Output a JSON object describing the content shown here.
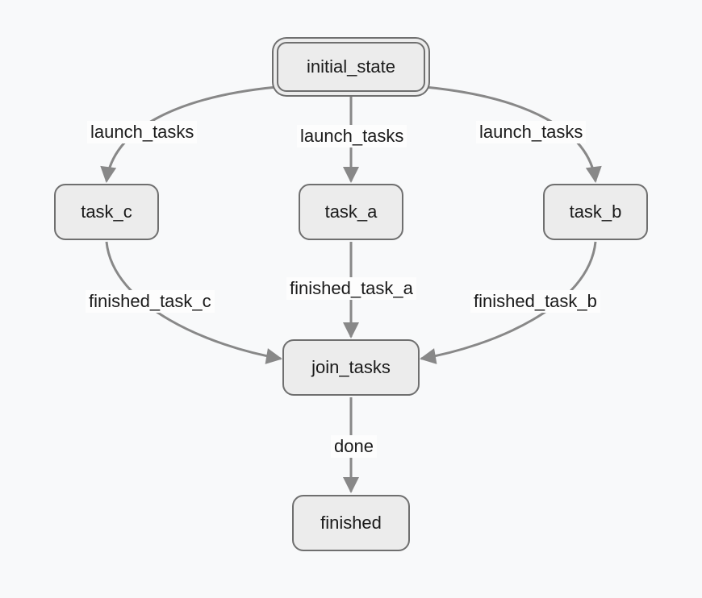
{
  "nodes": {
    "initial_state": {
      "label": "initial_state",
      "kind": "initial"
    },
    "task_c": {
      "label": "task_c",
      "kind": "state"
    },
    "task_a": {
      "label": "task_a",
      "kind": "state"
    },
    "task_b": {
      "label": "task_b",
      "kind": "state"
    },
    "join_tasks": {
      "label": "join_tasks",
      "kind": "state"
    },
    "finished": {
      "label": "finished",
      "kind": "state"
    }
  },
  "edges": {
    "initial_to_task_c": {
      "from": "initial_state",
      "to": "task_c",
      "label": "launch_tasks"
    },
    "initial_to_task_a": {
      "from": "initial_state",
      "to": "task_a",
      "label": "launch_tasks"
    },
    "initial_to_task_b": {
      "from": "initial_state",
      "to": "task_b",
      "label": "launch_tasks"
    },
    "task_c_to_join": {
      "from": "task_c",
      "to": "join_tasks",
      "label": "finished_task_c"
    },
    "task_a_to_join": {
      "from": "task_a",
      "to": "join_tasks",
      "label": "finished_task_a"
    },
    "task_b_to_join": {
      "from": "task_b",
      "to": "join_tasks",
      "label": "finished_task_b"
    },
    "join_to_finished": {
      "from": "join_tasks",
      "to": "finished",
      "label": "done"
    }
  }
}
